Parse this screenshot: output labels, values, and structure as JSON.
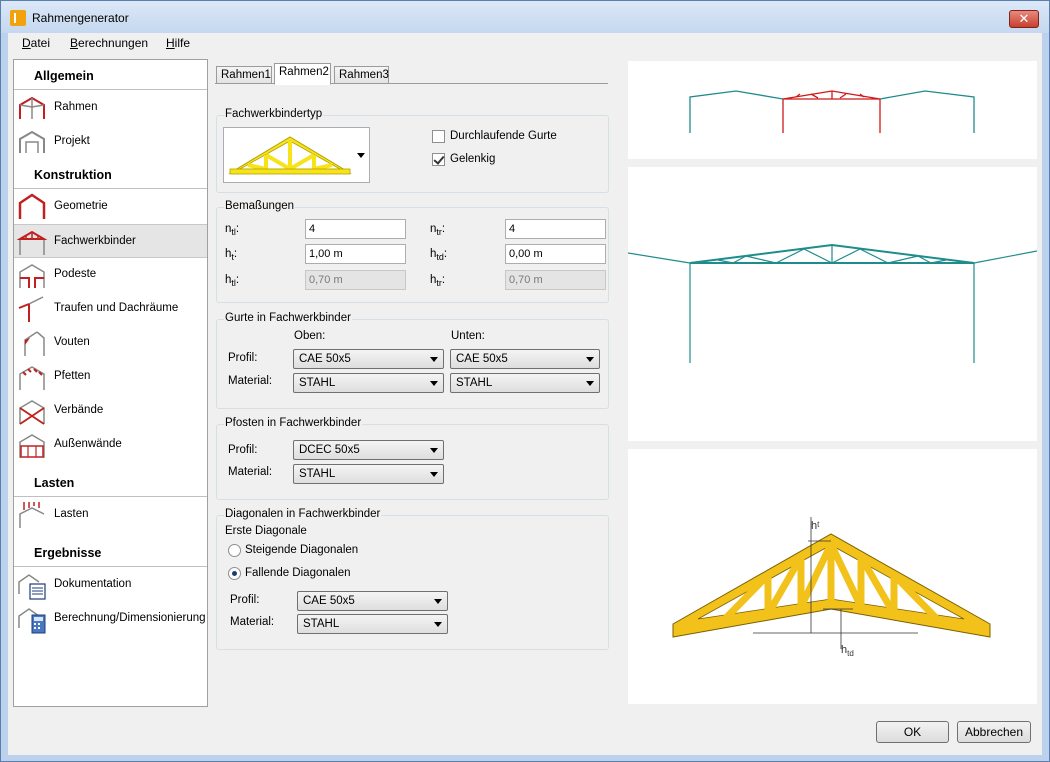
{
  "window": {
    "title": "Rahmengenerator",
    "close_glyph": "✕"
  },
  "menu": [
    {
      "accel": "D",
      "rest": "atei"
    },
    {
      "accel": "B",
      "rest": "erechnungen"
    },
    {
      "accel": "H",
      "rest": "ilfe"
    }
  ],
  "sidebar": {
    "sections": [
      "Allgemein",
      "Konstruktion",
      "Lasten",
      "Ergebnisse"
    ],
    "items": [
      {
        "label": "Rahmen",
        "icon": "frame-icon"
      },
      {
        "label": "Projekt",
        "icon": "project-icon"
      },
      {
        "label": "Geometrie",
        "icon": "geometry-icon"
      },
      {
        "label": "Fachwerkbinder",
        "icon": "truss-icon"
      },
      {
        "label": "Podeste",
        "icon": "platform-icon"
      },
      {
        "label": "Traufen und Dachräume",
        "icon": "eaves-icon"
      },
      {
        "label": "Vouten",
        "icon": "haunch-icon"
      },
      {
        "label": "Pfetten",
        "icon": "purlin-icon"
      },
      {
        "label": "Verbände",
        "icon": "bracing-icon"
      },
      {
        "label": "Außenwände",
        "icon": "wall-icon"
      },
      {
        "label": "Lasten",
        "icon": "load-icon"
      },
      {
        "label": "Dokumentation",
        "icon": "document-icon"
      },
      {
        "label": "Berechnung/Dimensionierung",
        "icon": "calculator-icon"
      }
    ]
  },
  "tabs": [
    "Rahmen1",
    "Rahmen2",
    "Rahmen3"
  ],
  "truss_type": {
    "title": "Fachwerkbindertyp",
    "durchlaufende_gurte": "Durchlaufende Gurte",
    "durchlaufende_gurte_checked": false,
    "gelenkig": "Gelenkig",
    "gelenkig_checked": true
  },
  "dims": {
    "title": "Bemaßungen",
    "n_tl": {
      "base": "n",
      "sub": "tl",
      "value": "4"
    },
    "n_tr": {
      "base": "n",
      "sub": "tr",
      "value": "4"
    },
    "h_t": {
      "base": "h",
      "sub": "t",
      "value": "1,00 m"
    },
    "h_td": {
      "base": "h",
      "sub": "td",
      "value": "0,00 m"
    },
    "h_tl": {
      "base": "h",
      "sub": "tl",
      "value": "0,70 m"
    },
    "h_tr": {
      "base": "h",
      "sub": "tr",
      "value": "0,70 m"
    }
  },
  "gurte": {
    "title": "Gurte in Fachwerkbinder",
    "oben": "Oben:",
    "unten": "Unten:",
    "profil_label": "Profil:",
    "material_label": "Material:",
    "profil_oben": "CAE 50x5",
    "profil_unten": "CAE 50x5",
    "material_oben": "STAHL",
    "material_unten": "STAHL"
  },
  "pfosten": {
    "title": "Pfosten in Fachwerkbinder",
    "profil_label": "Profil:",
    "material_label": "Material:",
    "profil": "DCEC 50x5",
    "material": "STAHL"
  },
  "diagonalen": {
    "title": "Diagonalen in Fachwerkbinder",
    "erste": "Erste Diagonale",
    "steigend": "Steigende Diagonalen",
    "fallend": "Fallende Diagonalen",
    "selected": "fallend",
    "profil_label": "Profil:",
    "material_label": "Material:",
    "profil": "CAE 50x5",
    "material": "STAHL"
  },
  "preview_labels": {
    "ht_base": "h",
    "ht_sub": "t",
    "htd_base": "h",
    "htd_sub": "td"
  },
  "buttons": {
    "ok": "OK",
    "cancel": "Abbrechen"
  },
  "colors": {
    "frame": "#1f8c8c",
    "highlight": "#d01818",
    "truss_fill": "#f2c21a",
    "truss_stroke": "#7a5f00"
  }
}
